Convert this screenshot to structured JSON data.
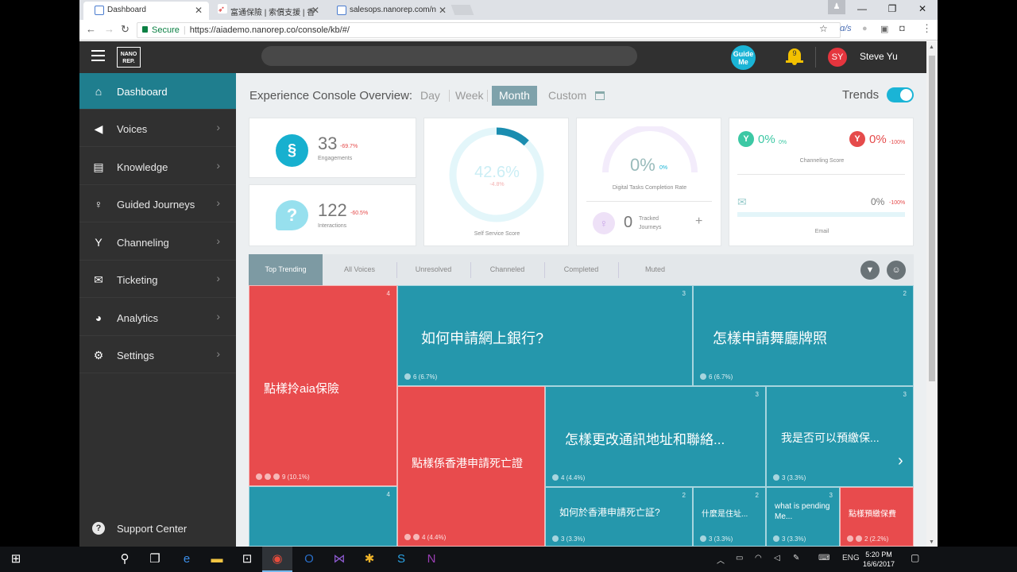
{
  "browser": {
    "tabs": [
      {
        "label": "Dashboard"
      },
      {
        "label": "富通保險 | 索償支援 | 香"
      },
      {
        "label": "salesops.nanorep.com/n"
      }
    ],
    "url": {
      "secure": "Secure",
      "address": "https://aiademo.nanorep.co/console/kb/#/"
    },
    "ext_label": "ɑ/s"
  },
  "header": {
    "logo": "NANO REP.",
    "guide": "Guide Me",
    "notifications": "9",
    "avatar": "SY",
    "user": "Steve Yu"
  },
  "sidebar": {
    "items": [
      {
        "label": "Dashboard",
        "icon": "home-icon"
      },
      {
        "label": "Voices",
        "icon": "megaphone-icon"
      },
      {
        "label": "Knowledge",
        "icon": "book-icon"
      },
      {
        "label": "Guided Journeys",
        "icon": "pin-icon"
      },
      {
        "label": "Channeling",
        "icon": "fork-icon"
      },
      {
        "label": "Ticketing",
        "icon": "envelope-icon"
      },
      {
        "label": "Analytics",
        "icon": "piechart-icon"
      },
      {
        "label": "Settings",
        "icon": "gear-icon"
      }
    ],
    "support": "Support Center"
  },
  "overview": {
    "title": "Experience Console Overview:",
    "periods": [
      "Day",
      "Week",
      "Month",
      "Custom"
    ],
    "selected": "Month",
    "trends": "Trends"
  },
  "cards": {
    "engagements": {
      "value": "33",
      "delta": "-69.7%",
      "label": "Engagements"
    },
    "interactions": {
      "value": "122",
      "delta": "-60.5%",
      "label": "Interactions"
    },
    "self_service": {
      "value": "42.6%",
      "delta": "-4.8%",
      "label": "Self Service Score",
      "fraction": 0.426
    },
    "digital": {
      "value": "0%",
      "delta": "0%",
      "label": "Digital Tasks Completion Rate"
    },
    "tracked": {
      "value": "0",
      "label": "Tracked Journeys"
    },
    "channeling": {
      "v1": "0%",
      "d1": "0%",
      "v2": "0%",
      "d2": "-100%",
      "label": "Channeling Score"
    },
    "email": {
      "value": "0%",
      "delta": "-100%",
      "label": "Email"
    }
  },
  "bottom_tabs": [
    "Top Trending",
    "All Voices",
    "Unresolved",
    "Channeled",
    "Completed",
    "Muted"
  ],
  "treemap": [
    {
      "text": "點樣拎aia保險",
      "count": "4",
      "stat": "9 (10.1%)",
      "color": "red"
    },
    {
      "text": "如何申請網上銀行?",
      "count": "3",
      "stat": "6 (6.7%)",
      "color": "blue"
    },
    {
      "text": "怎樣申請舞廳牌照",
      "count": "2",
      "stat": "6 (6.7%)",
      "color": "blue"
    },
    {
      "text": "點樣係香港申請死亡證",
      "count": "",
      "stat": "4 (4.4%)",
      "color": "red"
    },
    {
      "text": "怎樣更改通訊地址和聯絡...",
      "count": "3",
      "stat": "4 (4.4%)",
      "color": "blue"
    },
    {
      "text": "我是否可以預繳保...",
      "count": "3",
      "stat": "3 (3.3%)",
      "color": "blue"
    },
    {
      "text": "如何於香港申請死亡証?",
      "count": "2",
      "stat": "3 (3.3%)",
      "color": "blue"
    },
    {
      "text": "什麼是住址...",
      "count": "2",
      "stat": "3 (3.3%)",
      "color": "blue"
    },
    {
      "text": "what is pending Me...",
      "count": "3",
      "stat": "3 (3.3%)",
      "color": "blue"
    },
    {
      "text": "點樣預繳保費",
      "count": "",
      "stat": "2 (2.2%)",
      "color": "red"
    },
    {
      "text": "",
      "count": "4",
      "stat": "",
      "color": "blue"
    }
  ],
  "taskbar": {
    "lang": "ENG",
    "time": "5:20 PM",
    "date": "16/6/2017"
  }
}
